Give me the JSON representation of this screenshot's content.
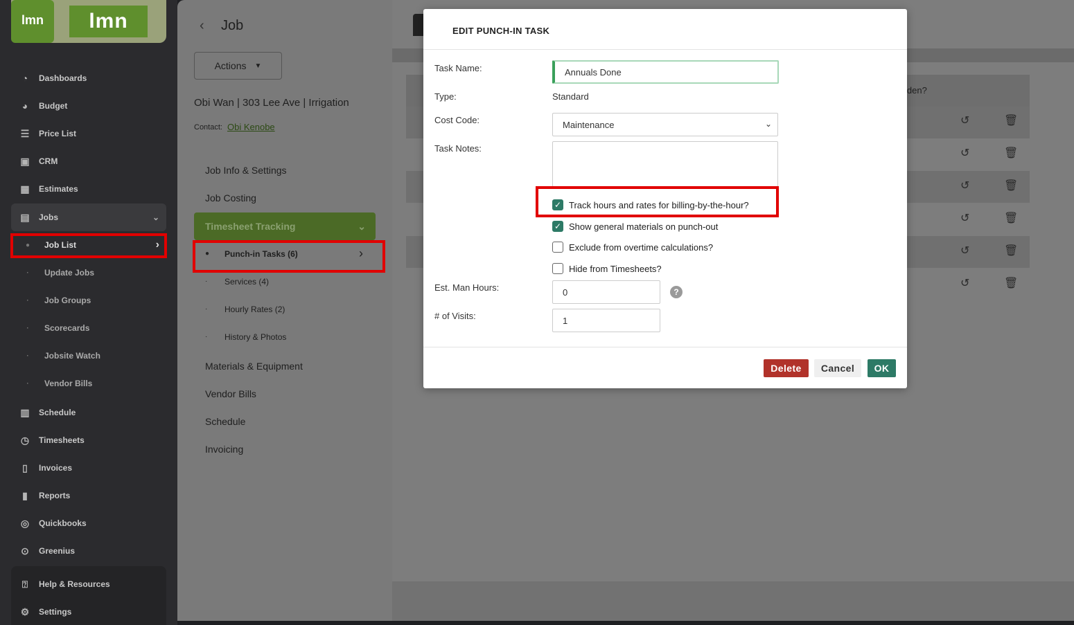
{
  "sidebar": {
    "logo_small": "lmn",
    "logo_big": "lmn",
    "items": [
      {
        "label": "Dashboards",
        "icon": "dashboard-icon"
      },
      {
        "label": "Budget",
        "icon": "pie-chart-icon"
      },
      {
        "label": "Price List",
        "icon": "list-icon"
      },
      {
        "label": "CRM",
        "icon": "contact-card-icon"
      },
      {
        "label": "Estimates",
        "icon": "calculator-icon"
      },
      {
        "label": "Jobs",
        "icon": "jobs-icon"
      }
    ],
    "jobs_sub": [
      "Job List",
      "Update Jobs",
      "Job Groups",
      "Scorecards",
      "Jobsite Watch",
      "Vendor Bills"
    ],
    "items_after": [
      {
        "label": "Schedule",
        "icon": "calendar-icon"
      },
      {
        "label": "Timesheets",
        "icon": "clock-icon"
      },
      {
        "label": "Invoices",
        "icon": "invoice-icon"
      },
      {
        "label": "Reports",
        "icon": "reports-icon"
      },
      {
        "label": "Quickbooks",
        "icon": "quickbooks-icon"
      },
      {
        "label": "Greenius",
        "icon": "play-circle-icon"
      }
    ],
    "help": "Help & Resources",
    "settings": "Settings"
  },
  "job_panel": {
    "back_label": "Job",
    "actions_label": "Actions",
    "job_title": "Obi Wan | 303 Lee Ave | Irrigation",
    "contact_label": "Contact:",
    "contact_name": "Obi Kenobe",
    "links_top": [
      "Job Info & Settings",
      "Job Costing"
    ],
    "active_section": "Timesheet Tracking",
    "sub_links": [
      "Punch-in Tasks (6)",
      "Services (4)",
      "Hourly Rates (2)",
      "History & Photos"
    ],
    "links_bottom": [
      "Materials & Equipment",
      "Vendor Bills",
      "Schedule",
      "Invoicing"
    ]
  },
  "background_table": {
    "partial_header": "lden?"
  },
  "modal": {
    "title": "EDIT PUNCH-IN TASK",
    "task_name_label": "Task Name:",
    "task_name_value": "Annuals Done",
    "type_label": "Type:",
    "type_value": "Standard",
    "cost_code_label": "Cost Code:",
    "cost_code_value": "Maintenance",
    "task_notes_label": "Task Notes:",
    "task_notes_value": "",
    "checkboxes": [
      {
        "label": "Track hours and rates for billing-by-the-hour?",
        "checked": true
      },
      {
        "label": "Show general materials on punch-out",
        "checked": true
      },
      {
        "label": "Exclude from overtime calculations?",
        "checked": false
      },
      {
        "label": "Hide from Timesheets?",
        "checked": false
      }
    ],
    "est_hours_label": "Est. Man Hours:",
    "est_hours_value": "0",
    "help_glyph": "?",
    "visits_label": "# of Visits:",
    "visits_value": "1",
    "delete_label": "Delete",
    "cancel_label": "Cancel",
    "ok_label": "OK"
  },
  "colors": {
    "brand_green": "#5f8f2d",
    "delete_red": "#b1322a",
    "ok_green": "#2d7a66",
    "highlight_red": "#e10000"
  }
}
